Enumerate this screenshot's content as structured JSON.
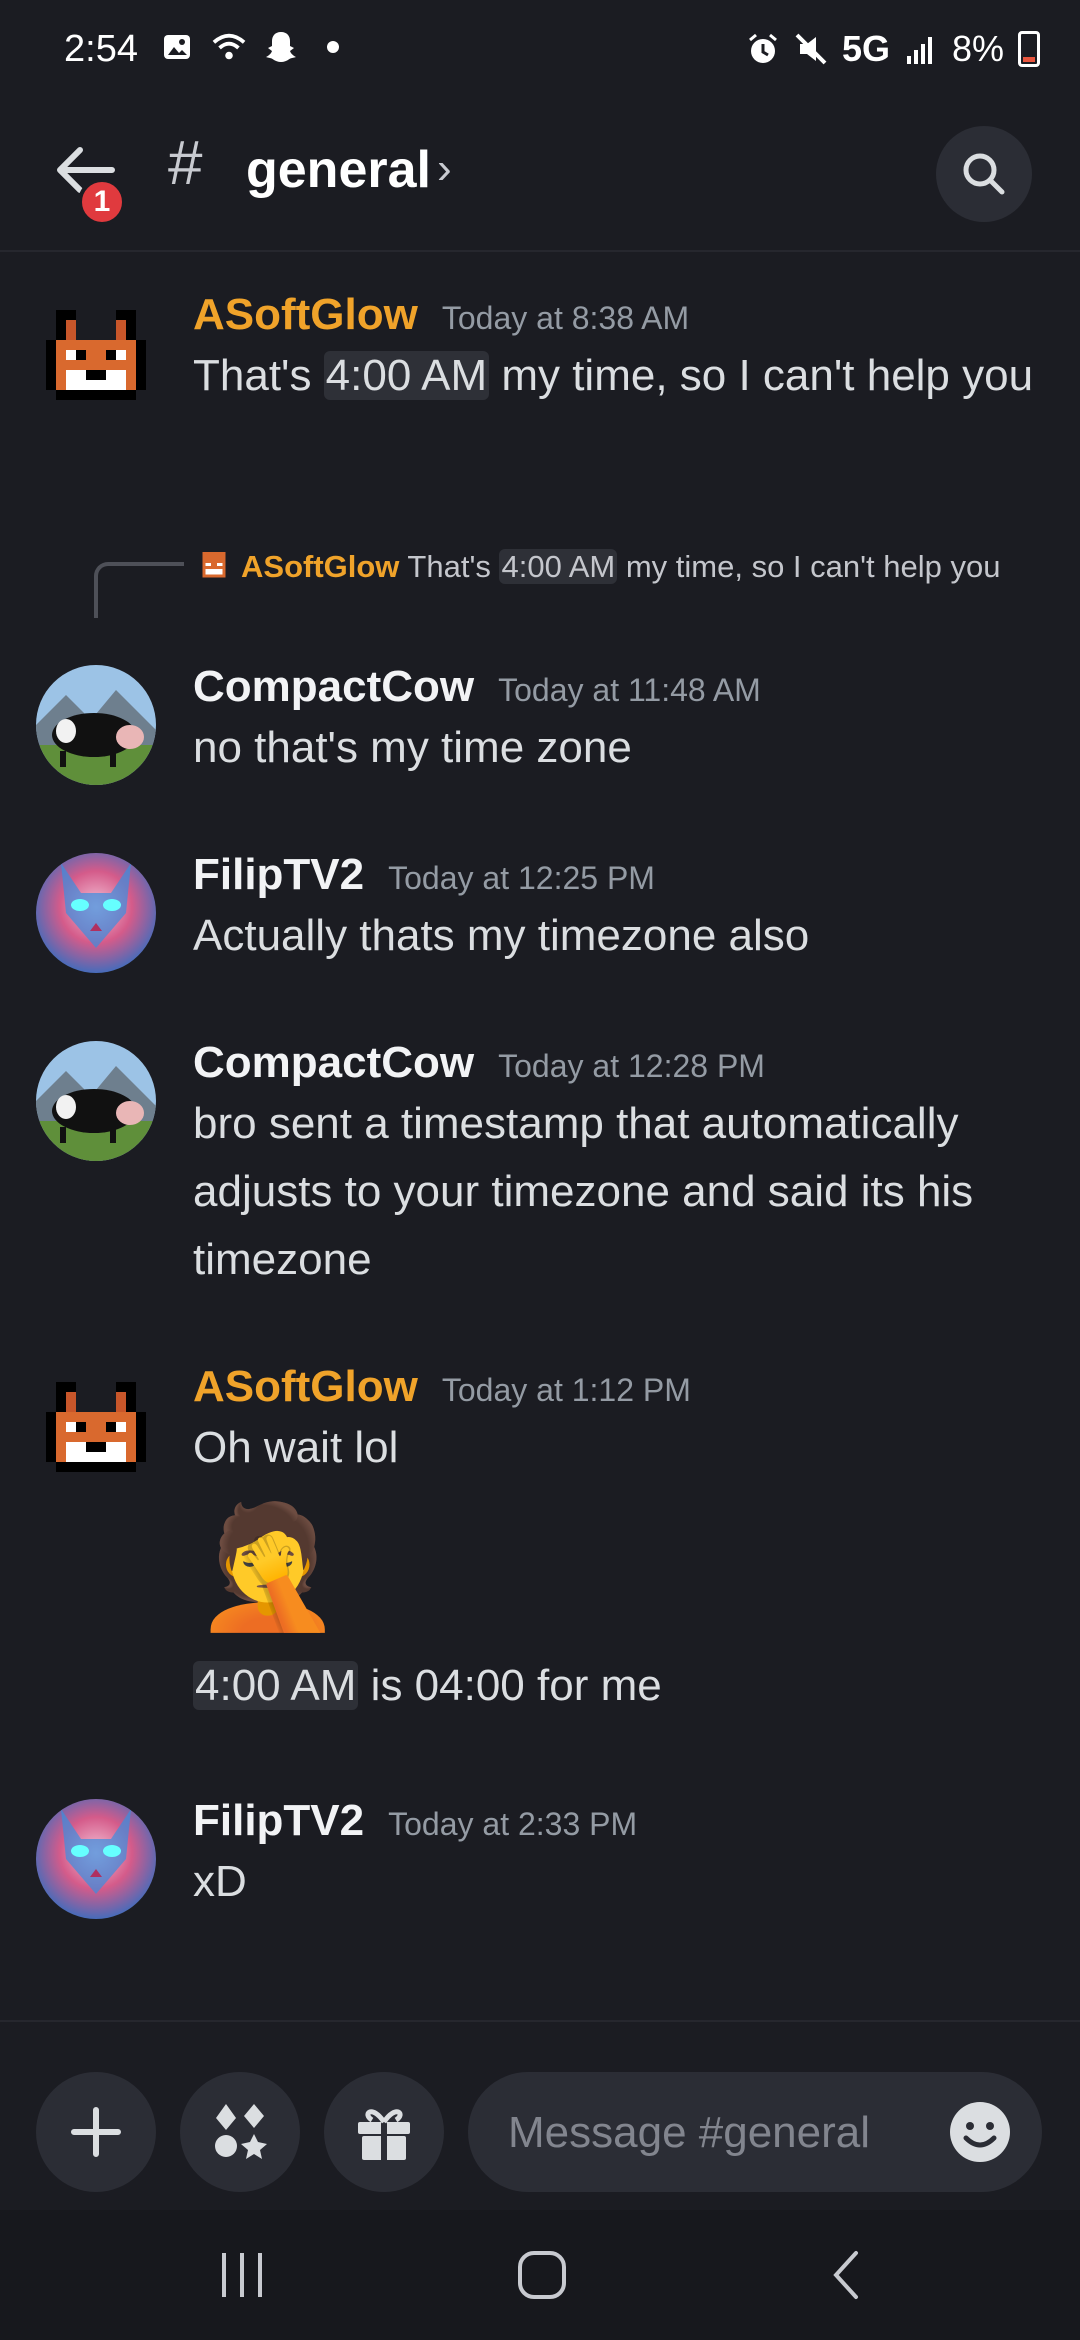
{
  "status_bar": {
    "time": "2:54",
    "network": "5G",
    "battery": "8%"
  },
  "header": {
    "notification_count": "1",
    "hash": "#",
    "channel_name": "general",
    "chevron": "›"
  },
  "messages": [
    {
      "author": "ASoftGlow",
      "author_color": "#f0a32a",
      "timestamp": "Today at 8:38 AM",
      "avatar": "fox-avatar",
      "text_pre": "That's ",
      "text_ts": "4:00 AM",
      "text_post": " my time, so I can't help you"
    },
    {
      "reply_to": {
        "author": "ASoftGlow",
        "text_pre": "That's ",
        "text_ts": "4:00 AM",
        "text_post": " my time, so I can't help you"
      },
      "author": "CompactCow",
      "timestamp": "Today at 11:48 AM",
      "avatar": "cow-avatar",
      "text": "no that's my time zone"
    },
    {
      "author": "FilipTV2",
      "timestamp": "Today at 12:25 PM",
      "avatar": "cat-avatar",
      "text": "Actually thats my timezone also"
    },
    {
      "author": "CompactCow",
      "timestamp": "Today at 12:28 PM",
      "avatar": "cow-avatar",
      "text": "bro sent a timestamp that automatically adjusts to your timezone and said its his timezone"
    },
    {
      "author": "ASoftGlow",
      "author_color": "#f0a32a",
      "timestamp": "Today at 1:12 PM",
      "avatar": "fox-avatar",
      "text": "Oh wait lol",
      "emoji": "🤦",
      "text2_ts": "4:00 AM",
      "text2_post": " is 04:00 for me"
    },
    {
      "author": "FilipTV2",
      "timestamp": "Today at 2:33 PM",
      "avatar": "cat-avatar",
      "text": "xD"
    }
  ],
  "composer": {
    "placeholder": "Message #general"
  },
  "colors": {
    "background": "#1b1c22",
    "accent_orange": "#f0a32a",
    "badge_red": "#e03a3e"
  }
}
